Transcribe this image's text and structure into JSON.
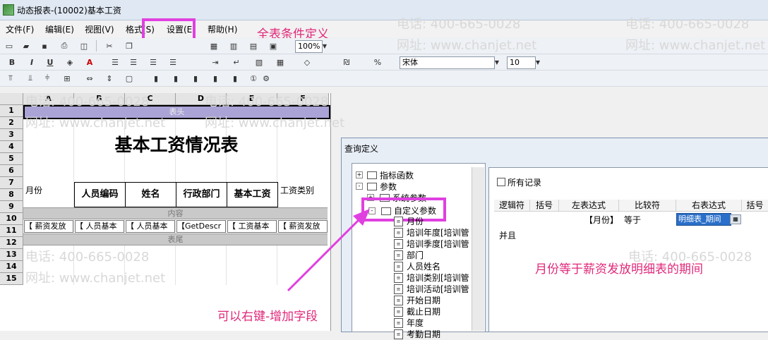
{
  "window": {
    "title": "动态报表-(10002)基本工资"
  },
  "menu": [
    "文件(F)",
    "编辑(E)",
    "视图(V)",
    "格式(S)",
    "设置(E)",
    "帮助(H)"
  ],
  "toolbar": {
    "zoom": "100%",
    "font": "宋体",
    "font_size": "10"
  },
  "sheet": {
    "columns": [
      "A",
      "B",
      "C",
      "D",
      "E",
      "F"
    ],
    "rows": [
      "1",
      "2",
      "3",
      "4",
      "5",
      "6",
      "7",
      "8",
      "9",
      "10",
      "11",
      "12",
      "13",
      "14",
      "15"
    ],
    "header_band": "表头",
    "report_title": "基本工资情况表",
    "row7_left": "月份",
    "headers": [
      "人员编码",
      "姓名",
      "行政部门",
      "基本工资"
    ],
    "row7_right": "工资类别",
    "content_band": "内容",
    "data_row": [
      "【 薪资发放",
      "【 人员基本",
      "【 人员基本",
      "【GetDescr",
      "【 工资基本",
      "【 薪资发放"
    ],
    "footer_band": "表尾"
  },
  "dialog": {
    "title": "查询定义",
    "tree": [
      {
        "label": "指标函数",
        "toggle": "+"
      },
      {
        "label": "参数",
        "toggle": "-"
      },
      {
        "label": "系统参数",
        "toggle": "+"
      },
      {
        "label": "自定义参数",
        "toggle": "-"
      },
      {
        "label": "月份"
      },
      {
        "label": "培训年度[培训管"
      },
      {
        "label": "培训季度[培训管"
      },
      {
        "label": "部门"
      },
      {
        "label": "人员姓名"
      },
      {
        "label": "培训类别[培训管"
      },
      {
        "label": "培训活动[培训管"
      },
      {
        "label": "开始日期"
      },
      {
        "label": "截止日期"
      },
      {
        "label": "年度"
      },
      {
        "label": "考勤日期"
      }
    ],
    "all_records_label": "所有记录",
    "table_headers": [
      "逻辑符",
      "括号",
      "左表达式",
      "比较符",
      "右表达式",
      "括号"
    ],
    "condition": {
      "left": "【月份】",
      "op": "等于",
      "right": "明细表_期间"
    },
    "and_label": "并且"
  },
  "annotations": {
    "settings_note": "全表条件定义",
    "tree_note": "可以右键-增加字段",
    "condition_note": "月份等于薪资发放明细表的期间"
  },
  "watermark": {
    "phone": "电话: 400-665-0028",
    "site": "网址: www.chanjet.net"
  },
  "colors": {
    "annotation": "#e0287a",
    "highlight": "#e040e0",
    "band": "#c9c9c9",
    "header_band": "#a9a3d6"
  }
}
